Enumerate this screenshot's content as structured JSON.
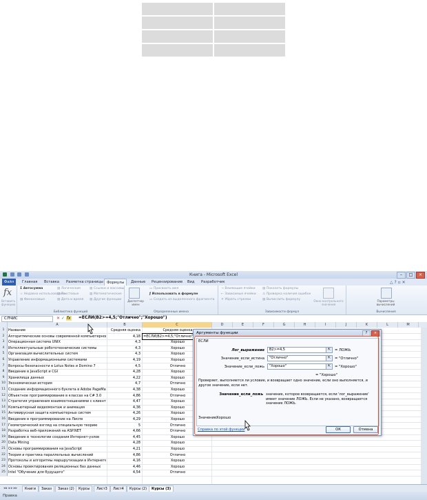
{
  "window": {
    "title": "Книга - Microsoft Excel"
  },
  "ribbon": {
    "tabs": [
      "Файл",
      "Главная",
      "Вставка",
      "Разметка страницы",
      "Формулы",
      "Данные",
      "Рецензирование",
      "Вид",
      "Разработчик"
    ],
    "active_tab": "Формулы",
    "insert_function": "Вставить функцию",
    "library": {
      "items": [
        "Автосумма",
        "Недавно использовались",
        "Финансовые",
        "Логические",
        "Текстовые",
        "Дата и время",
        "Ссылки и массивы",
        "Математические",
        "Другие функции"
      ],
      "label": "Библиотека функций"
    },
    "names": {
      "manager": "Диспетчер имен",
      "items": [
        "Присвоить имя",
        "Использовать в формуле",
        "Создать из выделенного фрагмента"
      ],
      "label": "Определенные имена"
    },
    "audit": {
      "items": [
        "Влияющие ячейки",
        "Зависимые ячейки",
        "Убрать стрелки",
        "Показать формулы",
        "Проверка наличия ошибок",
        "Вычислить формулу"
      ],
      "watch": "Окно контрольного значения",
      "label": "Зависимости формул"
    },
    "calc": {
      "params": "Параметры вычислений",
      "label": "Вычисления"
    }
  },
  "formula_bar": {
    "name_box": "СЛЧИС",
    "formula": "=ЕСЛИ(B2>=4,5;\"Отлично\";\"Хорошо\")"
  },
  "columns": [
    "A",
    "B",
    "C",
    "D",
    "E",
    "F",
    "G",
    "H",
    "I",
    "J",
    "K",
    "L",
    "M"
  ],
  "sheet": {
    "header": {
      "a": "Название",
      "b": "Средняя оценка",
      "c": "Средняя оценка"
    },
    "rows": [
      {
        "n": "2",
        "a": "Алгоритмические основы современной компьютерной",
        "b": "4,18",
        "c": "=ЕСЛИ(B2>=4,5;\"Отлично\";\"Хорошо\")"
      },
      {
        "n": "3",
        "a": "Операционная система UNIX",
        "b": "4,3",
        "c": "Хорошо"
      },
      {
        "n": "4",
        "a": "Интеллектуальные робототехнические системы",
        "b": "4,3",
        "c": "Хорошо"
      },
      {
        "n": "5",
        "a": "Организация вычислительных систем",
        "b": "4,3",
        "c": "Хорошо"
      },
      {
        "n": "6",
        "a": "Управление информационными системами",
        "b": "4,19",
        "c": "Хорошо"
      },
      {
        "n": "7",
        "a": "Вопросы безопасности в Lotus Notes и Domino 7",
        "b": "4,5",
        "c": "Отлично"
      },
      {
        "n": "8",
        "a": "Введение в JavaScript и CGI",
        "b": "4,28",
        "c": "Хорошо"
      },
      {
        "n": "9",
        "a": "Хранилища данных",
        "b": "4,22",
        "c": "Хорошо"
      },
      {
        "n": "10",
        "a": "Экономическая история",
        "b": "4,7",
        "c": "Отлично"
      },
      {
        "n": "11",
        "a": "Создание информационного буклета в Adobe PageMaker",
        "b": "4,38",
        "c": "Хорошо"
      },
      {
        "n": "12",
        "a": "Объектное программирование в классах на C# 3.0",
        "b": "4,86",
        "c": "Отлично"
      },
      {
        "n": "13",
        "a": "Стратегия управления взаимоотношениями с клиентами",
        "b": "4,47",
        "c": "Хорошо"
      },
      {
        "n": "14",
        "a": "Компьютерный видеомонтаж и анимация",
        "b": "4,36",
        "c": "Хорошо"
      },
      {
        "n": "15",
        "a": "Антивирусная защита компьютерных систем",
        "b": "4,26",
        "c": "Хорошо"
      },
      {
        "n": "16",
        "a": "Введение в программирование на Лиспе",
        "b": "4,29",
        "c": "Хорошо"
      },
      {
        "n": "17",
        "a": "Геометрический взгляд на специальную теорию",
        "b": "5",
        "c": "Отлично"
      },
      {
        "n": "18",
        "a": "Разработка веб-приложений на ASP.NET",
        "b": "4,66",
        "c": "Отлично"
      },
      {
        "n": "19",
        "a": "Введение в технологии создания Интернет-узлов",
        "b": "4,45",
        "c": "Хорошо"
      },
      {
        "n": "20",
        "a": "Data Mining",
        "b": "4,28",
        "c": "Хорошо"
      },
      {
        "n": "21",
        "a": "Основы программирования на JavaScript",
        "b": "4,21",
        "c": "Хорошо"
      },
      {
        "n": "22",
        "a": "Теория и практика параллельных вычислений",
        "b": "4,86",
        "c": "Отлично"
      },
      {
        "n": "23",
        "a": "Протоколы и алгоритмы маршрутизации в Интернете",
        "b": "4,16",
        "c": "Хорошо"
      },
      {
        "n": "24",
        "a": "Основы проектирования реляционных баз данных",
        "b": "4,46",
        "c": "Хорошо"
      },
      {
        "n": "25",
        "a": "Intel \"Обучение для будущего\"",
        "b": "4,54",
        "c": "Отлично"
      }
    ]
  },
  "sheet_tabs": [
    "Книги",
    "Заказ",
    "Заказ (2)",
    "Курсы",
    "Лист3",
    "Лист4",
    "Курсы (2)",
    "Курсы (3)"
  ],
  "status": {
    "mode": "Правка"
  },
  "dialog": {
    "title": "Аргументы функции",
    "function": "ЕСЛИ",
    "args": [
      {
        "label": "Лог_выражение",
        "value": "B2>=4,5",
        "result": "= ЛОЖЬ"
      },
      {
        "label": "Значение_если_истина",
        "value": "\"Отлично\"",
        "result": "= \"Отлично\""
      },
      {
        "label": "Значение_если_ложь",
        "value": "\"Хорошо\"",
        "result": "= \"Хорошо\""
      }
    ],
    "total": "= \"Хорошо\"",
    "description": "Проверяет, выполняется ли условие, и возвращает одно значение, если оно выполняется, и другое значение, если нет.",
    "arg_name": "Значение_если_ложь",
    "arg_desc": "значение, которое возвращается, если 'лог_выражение' имеет значение ЛОЖЬ. Если не указано, возвращается значение ЛОЖЬ.",
    "value_label": "Значение:",
    "value": "Хорошо",
    "help_link": "Справка по этой функции",
    "ok": "ОК",
    "cancel": "Отмена"
  }
}
